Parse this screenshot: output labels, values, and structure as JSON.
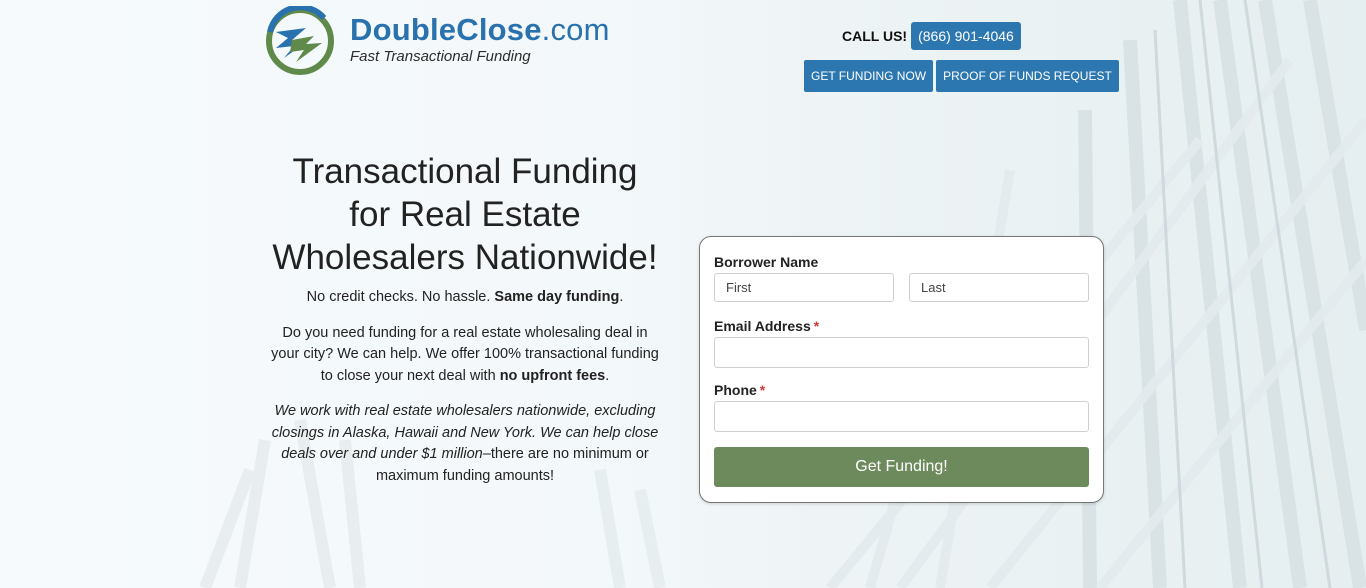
{
  "brand": {
    "name_main": "DoubleClose",
    "name_domain": ".com",
    "tagline": "Fast Transactional Funding"
  },
  "header": {
    "callus_label": "CALL US!",
    "phone": "(866) 901-4046",
    "buttons": [
      "GET FUNDING NOW",
      "PROOF OF FUNDS REQUEST"
    ]
  },
  "hero": {
    "title": "Transactional Funding for Real Estate Wholesalers Nationwide!",
    "lead_plain": "No credit checks. No hassle. ",
    "lead_bold": "Same day funding",
    "lead_end": ".",
    "para_plain": "Do you need funding for a real estate wholesaling deal in your city? We can help. We offer 100% transactional funding to close your next deal with ",
    "para_bold": "no upfront fees",
    "para_end": ".",
    "italic_text": "We work with real estate wholesalers nationwide, excluding closings in Alaska, Hawaii and New York. We can help close deals over and under $1 million–",
    "closing_text": "there are no minimum or maximum funding amounts!"
  },
  "form": {
    "name_label": "Borrower Name",
    "first_placeholder": "First",
    "last_placeholder": "Last",
    "email_label": "Email Address",
    "phone_label": "Phone",
    "required_mark": "*",
    "submit_label": "Get Funding!"
  },
  "colors": {
    "brand_blue": "#2c77b0",
    "submit_green": "#6d8a5c",
    "logo_green": "#5f8a4a",
    "required_red": "#d23a3a"
  }
}
